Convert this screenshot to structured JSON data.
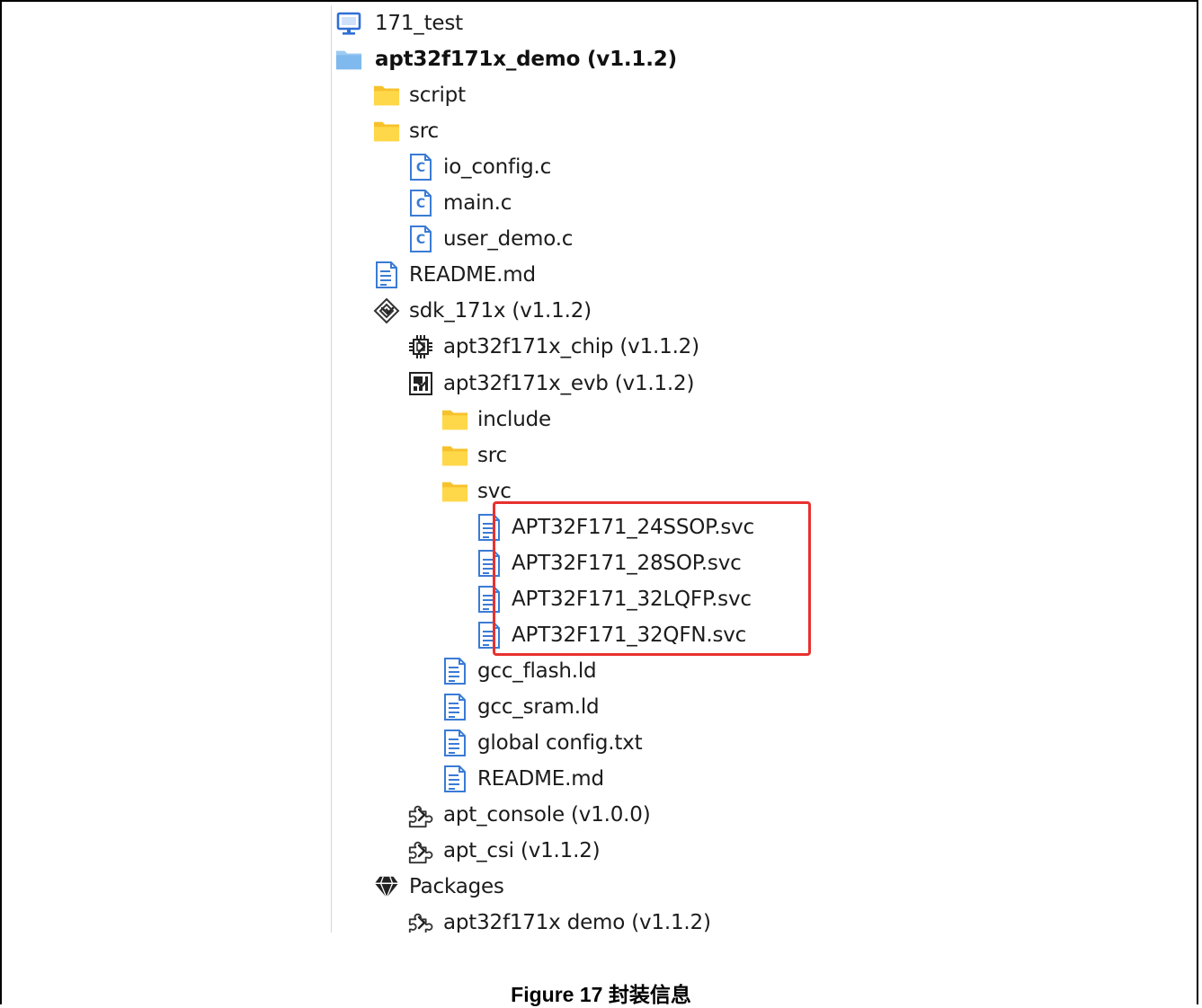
{
  "caption": "Figure 17 封装信息",
  "tree": [
    {
      "label": "171_test",
      "depth": 0,
      "icon": "monitor-icon",
      "chevron": "none",
      "bold": false
    },
    {
      "label": "apt32f171x_demo (v1.1.2)",
      "depth": 0,
      "icon": "folder-blue-icon",
      "chevron": "down",
      "bold": true
    },
    {
      "label": "script",
      "depth": 1,
      "icon": "folder-icon",
      "chevron": "right",
      "bold": false
    },
    {
      "label": "src",
      "depth": 1,
      "icon": "folder-icon",
      "chevron": "down",
      "bold": false
    },
    {
      "label": "io_config.c",
      "depth": 2,
      "icon": "c-file-icon",
      "chevron": "none",
      "bold": false
    },
    {
      "label": "main.c",
      "depth": 2,
      "icon": "c-file-icon",
      "chevron": "none",
      "bold": false
    },
    {
      "label": "user_demo.c",
      "depth": 2,
      "icon": "c-file-icon",
      "chevron": "none",
      "bold": false
    },
    {
      "label": "README.md",
      "depth": 1,
      "icon": "text-file-icon",
      "chevron": "none",
      "bold": false
    },
    {
      "label": "sdk_171x (v1.1.2)",
      "depth": 1,
      "icon": "sdk-diamond-icon",
      "chevron": "down",
      "bold": false
    },
    {
      "label": "apt32f171x_chip (v1.1.2)",
      "depth": 2,
      "icon": "chip-icon",
      "chevron": "right",
      "bold": false
    },
    {
      "label": "apt32f171x_evb (v1.1.2)",
      "depth": 2,
      "icon": "board-icon",
      "chevron": "down",
      "bold": false
    },
    {
      "label": "include",
      "depth": 3,
      "icon": "folder-icon",
      "chevron": "right",
      "bold": false
    },
    {
      "label": "src",
      "depth": 3,
      "icon": "folder-icon",
      "chevron": "right",
      "bold": false
    },
    {
      "label": "svc",
      "depth": 3,
      "icon": "folder-icon",
      "chevron": "down",
      "bold": false
    },
    {
      "label": "APT32F171_24SSOP.svc",
      "depth": 4,
      "icon": "text-file-icon",
      "chevron": "none",
      "bold": false
    },
    {
      "label": "APT32F171_28SOP.svc",
      "depth": 4,
      "icon": "text-file-icon",
      "chevron": "none",
      "bold": false
    },
    {
      "label": "APT32F171_32LQFP.svc",
      "depth": 4,
      "icon": "text-file-icon",
      "chevron": "none",
      "bold": false
    },
    {
      "label": "APT32F171_32QFN.svc",
      "depth": 4,
      "icon": "text-file-icon",
      "chevron": "none",
      "bold": false
    },
    {
      "label": "gcc_flash.ld",
      "depth": 3,
      "icon": "text-file-icon",
      "chevron": "none",
      "bold": false
    },
    {
      "label": "gcc_sram.ld",
      "depth": 3,
      "icon": "text-file-icon",
      "chevron": "none",
      "bold": false
    },
    {
      "label": "global config.txt",
      "depth": 3,
      "icon": "text-file-icon",
      "chevron": "none",
      "bold": false
    },
    {
      "label": "README.md",
      "depth": 3,
      "icon": "text-file-icon",
      "chevron": "none",
      "bold": false
    },
    {
      "label": "apt_console (v1.0.0)",
      "depth": 2,
      "icon": "puzzle-icon",
      "chevron": "right",
      "bold": false
    },
    {
      "label": "apt_csi (v1.1.2)",
      "depth": 2,
      "icon": "puzzle-icon",
      "chevron": "right",
      "bold": false
    },
    {
      "label": "Packages",
      "depth": 1,
      "icon": "packages-icon",
      "chevron": "down",
      "bold": false
    },
    {
      "label": "apt32f171x demo (v1.1.2)",
      "depth": 2,
      "icon": "puzzle-icon",
      "chevron": "right",
      "bold": false
    }
  ],
  "highlight_box_color": "#e8312f"
}
